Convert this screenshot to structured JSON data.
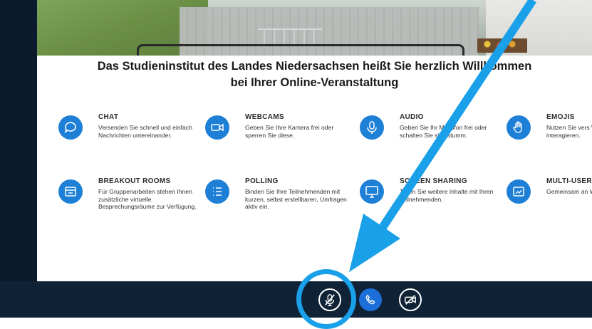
{
  "slide": {
    "title_line1": "Das Studieninstitut des Landes Niedersachsen heißt Sie herzlich Willkommen",
    "title_line2": "bei Ihrer Online-Veranstaltung",
    "features": [
      {
        "heading": "CHAT",
        "desc": "Versenden Sie schnell und einfach Nachrichten untereinander.",
        "icon": "chat-icon"
      },
      {
        "heading": "WEBCAMS",
        "desc": "Geben Sie Ihre Kamera frei oder sperren Sie diese.",
        "icon": "webcam-icon"
      },
      {
        "heading": "AUDIO",
        "desc": "Geben Sie Ihr Mikrofon frei oder schalten Sie sich stumm.",
        "icon": "microphone-icon"
      },
      {
        "heading": "EMOJIS",
        "desc": "Nutzen Sie vers Werkzeuge um interagieren.",
        "icon": "hand-icon"
      },
      {
        "heading": "BREAKOUT ROOMS",
        "desc": "Für Gruppenarbeiten stehen Ihnen zusätzliche virtuelle Besprechungsräume zur Verfügung.",
        "icon": "breakout-icon"
      },
      {
        "heading": "POLLING",
        "desc": "Binden Sie Ihre Teilnehmenden mit kurzen, selbst erstellbaren, Umfragen aktiv ein.",
        "icon": "poll-icon"
      },
      {
        "heading": "SCREEN SHARING",
        "desc": "Teilen Sie weitere Inhalte mit Ihren Teilnehmenden.",
        "icon": "screen-icon"
      },
      {
        "heading": "MULTI-USER",
        "desc": "Gemeinsam an Whiteboard ar",
        "icon": "whiteboard-icon"
      }
    ]
  },
  "controls": {
    "mic": {
      "icon": "microphone-muted-icon"
    },
    "phone": {
      "icon": "phone-icon"
    },
    "camera": {
      "icon": "camera-off-icon"
    }
  },
  "colors": {
    "accent": "#1d7fd6",
    "annotation": "#1aa0e8",
    "chrome": "#0f2236"
  }
}
